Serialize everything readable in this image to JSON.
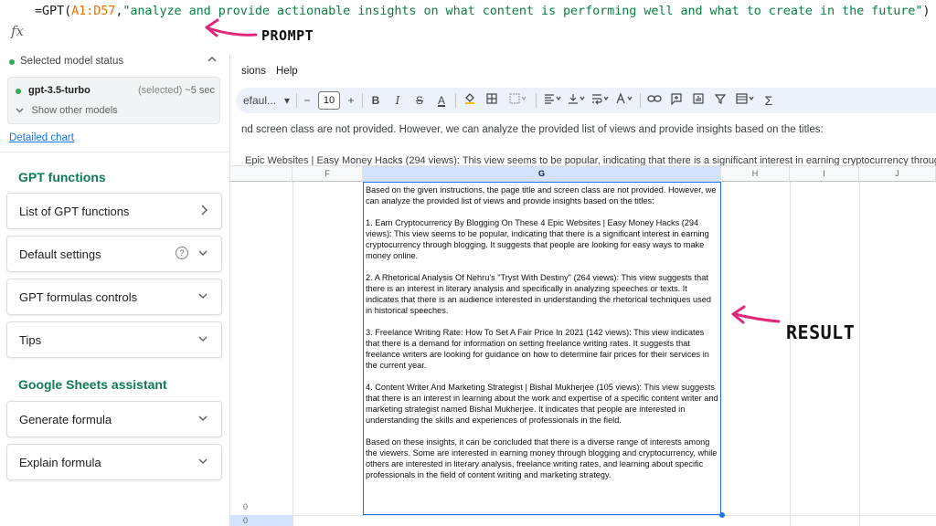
{
  "formula": {
    "prefix": "=GPT(",
    "range": "A1:D57",
    "comma": ",",
    "prompt_string": "\"analyze and provide actionable insights on what content is performing well and what to create in the future\"",
    "suffix": ")",
    "fx_label": "fx"
  },
  "annotations": {
    "prompt_label": "PROMPT",
    "result_label": "RESULT",
    "arrow_color": "#e0287a"
  },
  "sidebar": {
    "model_status_label": "Selected model status",
    "model": {
      "name": "gpt-3.5-turbo",
      "selected_label": "(selected)",
      "latency": "~5 sec"
    },
    "show_other_models": "Show other models",
    "detailed_chart": "Detailed chart",
    "gpt_functions_title": "GPT functions",
    "cards_gpt": [
      {
        "label": "List of GPT functions",
        "icon": "chevron-right-icon"
      },
      {
        "label": "Default settings",
        "icon": "chevron-down-icon"
      },
      {
        "label": "GPT formulas controls",
        "icon": "chevron-down-icon"
      },
      {
        "label": "Tips",
        "icon": "chevron-down-icon"
      }
    ],
    "help_glyph": "?",
    "assistant_title": "Google Sheets assistant",
    "cards_assistant": [
      {
        "label": "Generate formula",
        "icon": "chevron-down-icon"
      },
      {
        "label": "Explain formula",
        "icon": "chevron-down-icon"
      }
    ],
    "accent_color": "#0f7b54"
  },
  "sheet": {
    "menu": [
      "sions",
      "Help"
    ],
    "toolbar": {
      "font": "efaul...",
      "font_size": "10",
      "minus": "−",
      "plus": "+",
      "bold": "B",
      "italic": "I",
      "strike": "S",
      "text_color": "A",
      "sigma": "Σ"
    },
    "preview_line": "nd screen class are not provided. However, we can analyze the provided list of views and provide insights based on the titles:",
    "preview_line2": "Epic Websites | Easy Money Hacks (294 views): This view seems to be popular, indicating that there is a significant interest in earning cryptocurrency through b",
    "columns": [
      "F",
      "G",
      "H",
      "I",
      "J"
    ],
    "selected_column": "G",
    "row_numbers": [
      "0",
      "0"
    ],
    "result_paragraphs": [
      "Based on the given instructions, the page title and screen class are not provided. However, we can analyze the provided list of views and provide insights based on the titles:",
      "1. Earn Cryptocurrency By Blogging On These 4 Epic Websites | Easy Money Hacks (294 views): This view seems to be popular, indicating that there is a significant interest in earning cryptocurrency through blogging. It suggests that people are looking for easy ways to make money online.",
      "2. A Rhetorical Analysis Of Nehru's \"Tryst With Destiny\" (264 views): This view suggests that there is an interest in literary analysis and specifically in analyzing speeches or texts. It indicates that there is an audience interested in understanding the rhetorical techniques used in historical speeches.",
      "3. Freelance Writing Rate: How To Set A Fair Price In 2021 (142 views): This view indicates that there is a demand for information on setting freelance writing rates. It suggests that freelance writers are looking for guidance on how to determine fair prices for their services in the current year.",
      "4. Content Writer And Marketing Strategist | Bishal Mukherjee (105 views): This view suggests that there is an interest in learning about the work and expertise of a specific content writer and marketing strategist named Bishal Mukherjee. It indicates that people are interested in understanding the skills and experiences of professionals in the field.",
      "Based on these insights, it can be concluded that there is a diverse range of interests among the viewers. Some are interested in earning money through blogging and cryptocurrency, while others are interested in literary analysis, freelance writing rates, and learning about specific professionals in the field of content writing and marketing strategy."
    ]
  }
}
